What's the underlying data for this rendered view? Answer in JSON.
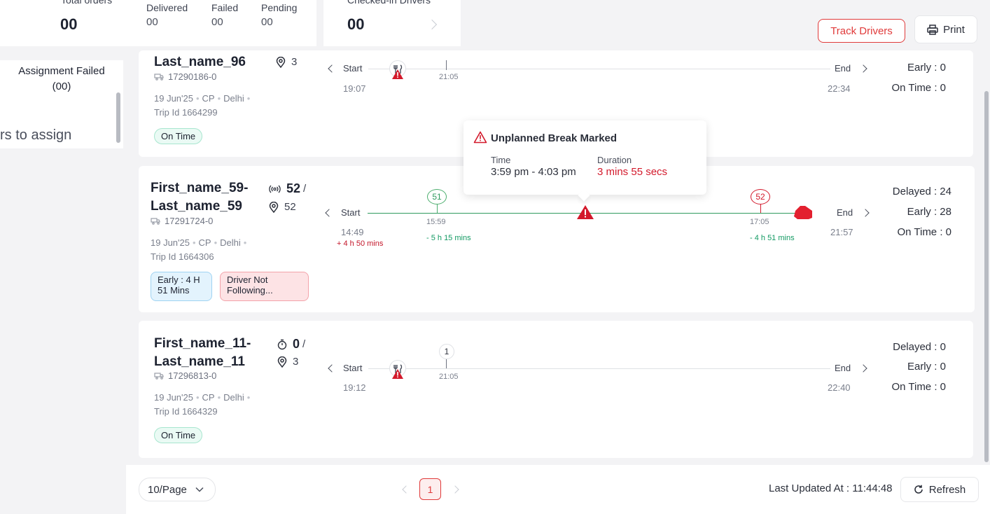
{
  "stats": {
    "total_orders_label": "Total orders",
    "total_orders_value": "00",
    "delivered_label": "Delivered",
    "delivered_value": "00",
    "failed_label": "Failed",
    "failed_value": "00",
    "pending_label": "Pending",
    "pending_value": "00",
    "checked_in_label": "Checked-in Drivers",
    "checked_in_value": "00"
  },
  "toolbar": {
    "track_drivers_label": "Track Drivers",
    "print_label": "Print"
  },
  "left_panel": {
    "assignment_failed_label": "Assignment Failed",
    "assignment_failed_count": "(00)",
    "assign_text": "rs to assign"
  },
  "tooltip": {
    "title": "Unplanned Break Marked",
    "time_label": "Time",
    "time_value": "3:59 pm - 4:03 pm",
    "duration_label": "Duration",
    "duration_value": "3 mins 55 secs"
  },
  "trips": [
    {
      "name_line2": "Last_name_96",
      "vehicle": "17290186-0",
      "date": "19 Jun'25",
      "zone": "CP",
      "city": "Delhi",
      "trip_id": "Trip Id 1664299",
      "stop_count": "3",
      "badges": [
        "On Time"
      ],
      "timeline": {
        "start_label": "Start",
        "end_label": "End",
        "start_time": "19:07",
        "end_time": "22:34",
        "stop_time": "21:05"
      },
      "right_stats": {
        "early": "Early : 0",
        "on_time": "On Time : 0"
      }
    },
    {
      "name_line1": "First_name_59-",
      "name_line2": "Last_name_59",
      "vehicle": "17291724-0",
      "date": "19 Jun'25",
      "zone": "CP",
      "city": "Delhi",
      "trip_id": "Trip Id 1664306",
      "signal_count": "52",
      "signal_sep": "/",
      "stop_count": "52",
      "badges": [
        "Early : 4 H 51 Mins",
        "Driver Not Following..."
      ],
      "timeline": {
        "start_label": "Start",
        "end_label": "End",
        "start_time": "14:49",
        "start_diff": "+ 4 h 50 mins",
        "end_time": "21:57",
        "stop1_number": "51",
        "stop1_time": "15:59",
        "stop1_diff": "- 5 h 15 mins",
        "stop2_number": "52",
        "stop2_time": "17:05",
        "stop2_diff": "- 4 h 51 mins"
      },
      "right_stats": {
        "delayed": "Delayed : 24",
        "early": "Early : 28",
        "on_time": "On Time : 0"
      }
    },
    {
      "name_line1": "First_name_11-",
      "name_line2": "Last_name_11",
      "vehicle": "17296813-0",
      "date": "19 Jun'25",
      "zone": "CP",
      "city": "Delhi",
      "trip_id": "Trip Id 1664329",
      "timer_count": "0",
      "timer_sep": "/",
      "stop_count": "3",
      "badges": [
        "On Time"
      ],
      "timeline": {
        "start_label": "Start",
        "end_label": "End",
        "start_time": "19:12",
        "end_time": "22:40",
        "stop_number": "1",
        "stop_time": "21:05"
      },
      "right_stats": {
        "delayed": "Delayed : 0",
        "early": "Early : 0",
        "on_time": "On Time : 0"
      }
    }
  ],
  "footer": {
    "page_size": "10/Page",
    "current_page": "1",
    "last_updated": "Last Updated At : 11:44:48",
    "refresh_label": "Refresh"
  },
  "colors": {
    "accent": "#e03a3a",
    "danger": "#d3192b",
    "success": "#2f9b5f"
  }
}
